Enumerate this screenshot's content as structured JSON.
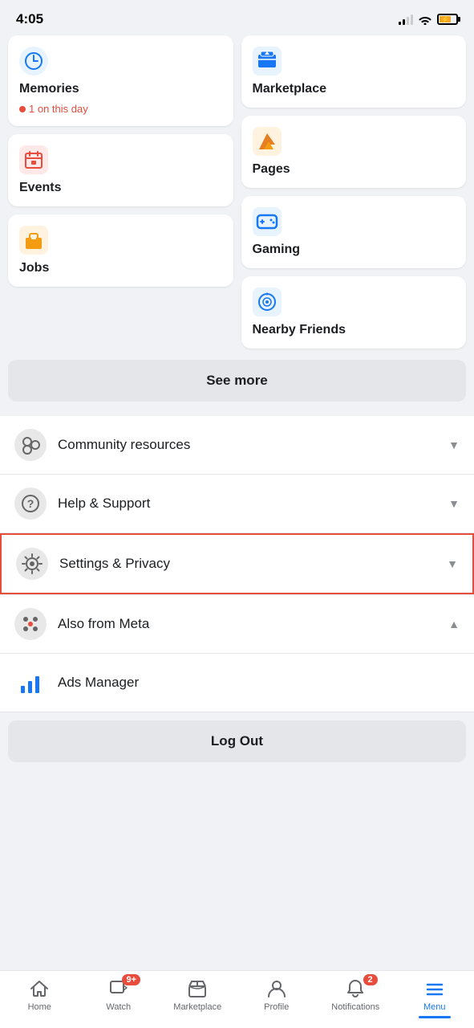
{
  "status": {
    "time": "4:05",
    "battery_pct": 70
  },
  "grid": {
    "left_items": [
      {
        "id": "memories",
        "label": "Memories",
        "sublabel": "1 on this day",
        "has_dot": true
      },
      {
        "id": "events",
        "label": "Events",
        "has_dot": false
      },
      {
        "id": "jobs",
        "label": "Jobs",
        "has_dot": false
      }
    ],
    "right_items": [
      {
        "id": "marketplace",
        "label": "Marketplace"
      },
      {
        "id": "pages",
        "label": "Pages"
      },
      {
        "id": "gaming",
        "label": "Gaming"
      },
      {
        "id": "nearby_friends",
        "label": "Nearby Friends"
      }
    ]
  },
  "see_more": "See more",
  "menu_items": [
    {
      "id": "community_resources",
      "label": "Community resources",
      "chevron": "▼",
      "highlighted": false
    },
    {
      "id": "help_support",
      "label": "Help & Support",
      "chevron": "▼",
      "highlighted": false
    },
    {
      "id": "settings_privacy",
      "label": "Settings & Privacy",
      "chevron": "▼",
      "highlighted": true
    }
  ],
  "also_from_meta": {
    "label": "Also from Meta",
    "chevron": "▲"
  },
  "ads_manager": {
    "label": "Ads Manager"
  },
  "log_out": "Log Out",
  "bottom_nav": {
    "items": [
      {
        "id": "home",
        "label": "Home",
        "active": false,
        "badge": null
      },
      {
        "id": "watch",
        "label": "Watch",
        "active": false,
        "badge": "9+"
      },
      {
        "id": "marketplace",
        "label": "Marketplace",
        "active": false,
        "badge": null
      },
      {
        "id": "profile",
        "label": "Profile",
        "active": false,
        "badge": null
      },
      {
        "id": "notifications",
        "label": "Notifications",
        "active": false,
        "badge": "2"
      },
      {
        "id": "menu",
        "label": "Menu",
        "active": true,
        "badge": null
      }
    ]
  }
}
